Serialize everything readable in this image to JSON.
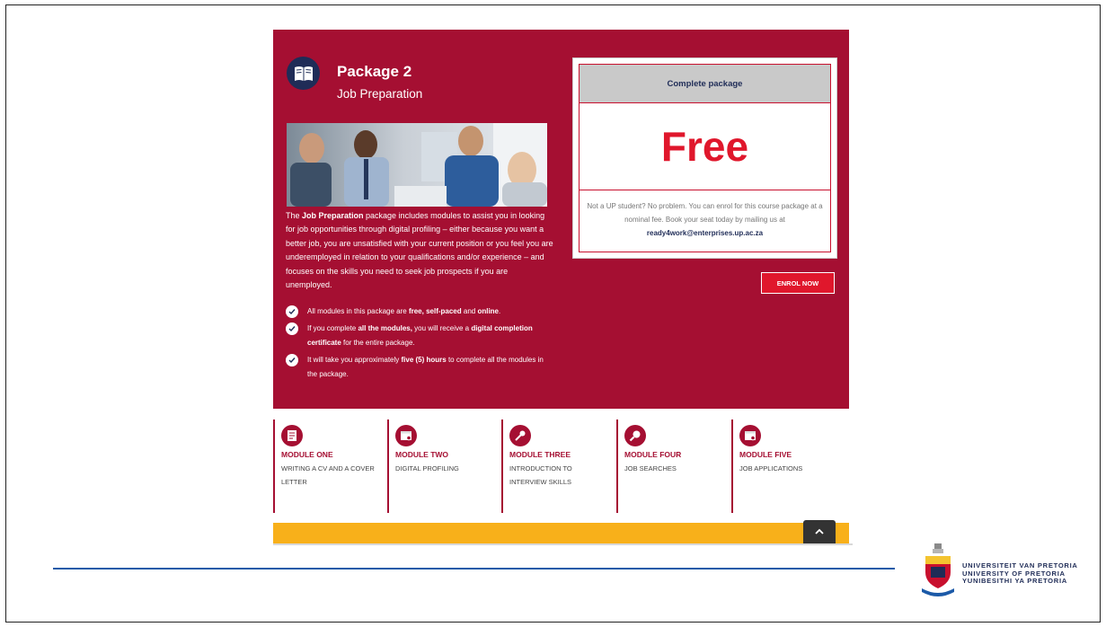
{
  "package": {
    "title": "Package 2",
    "subtitle": "Job Preparation",
    "icon": "book-icon"
  },
  "description": {
    "pre": "The ",
    "strong": "Job Preparation",
    "post": " package includes modules to assist you in looking for job opportunities through digital profiling – either because you want a better job, you are unsatisfied with your current position or you feel you are underemployed in relation to your qualifications and/or experience – and focuses on the skills you need to seek job prospects if you are unemployed."
  },
  "bullets": [
    {
      "t1": "All modules in this package are ",
      "b1": "free, self-paced",
      "t2": " and ",
      "b2": "online",
      "t3": "."
    },
    {
      "t1": "If you complete ",
      "b1": "all the modules,",
      "t2": " you will receive a ",
      "b2": "digital completion certificate",
      "t3": " for the entire package."
    },
    {
      "t1": "It will take you approximately ",
      "b1": "five (5) hours",
      "t2": " to complete all the modules in the package.",
      "b2": "",
      "t3": ""
    }
  ],
  "price_card": {
    "header": "Complete package",
    "price": "Free",
    "note": "Not a UP student? No problem. You can enrol for this course package at a nominal fee. Book your seat today by mailing us at ",
    "email": "ready4work@enterprises.up.ac.za"
  },
  "enrol_button": "ENROL NOW",
  "modules": [
    {
      "name": "MODULE ONE",
      "desc": "WRITING A CV AND A COVER LETTER",
      "icon": "document-icon"
    },
    {
      "name": "MODULE TWO",
      "desc": "DIGITAL PROFILING",
      "icon": "web-profile-icon"
    },
    {
      "name": "MODULE THREE",
      "desc": "INTRODUCTION TO INTERVIEW SKILLS",
      "icon": "microphone-icon"
    },
    {
      "name": "MODULE FOUR",
      "desc": "JOB SEARCHES",
      "icon": "magnifier-icon"
    },
    {
      "name": "MODULE FIVE",
      "desc": "JOB APPLICATIONS",
      "icon": "web-application-icon"
    }
  ],
  "university": {
    "line1": "UNIVERSITEIT VAN PRETORIA",
    "line2": "UNIVERSITY OF PRETORIA",
    "line3": "YUNIBESITHI YA PRETORIA"
  },
  "colors": {
    "maroon": "#a50f32",
    "red": "#e0172c",
    "navy": "#1f2c57",
    "yellow": "#f8b01a",
    "blue_rule": "#1c5aa8"
  }
}
